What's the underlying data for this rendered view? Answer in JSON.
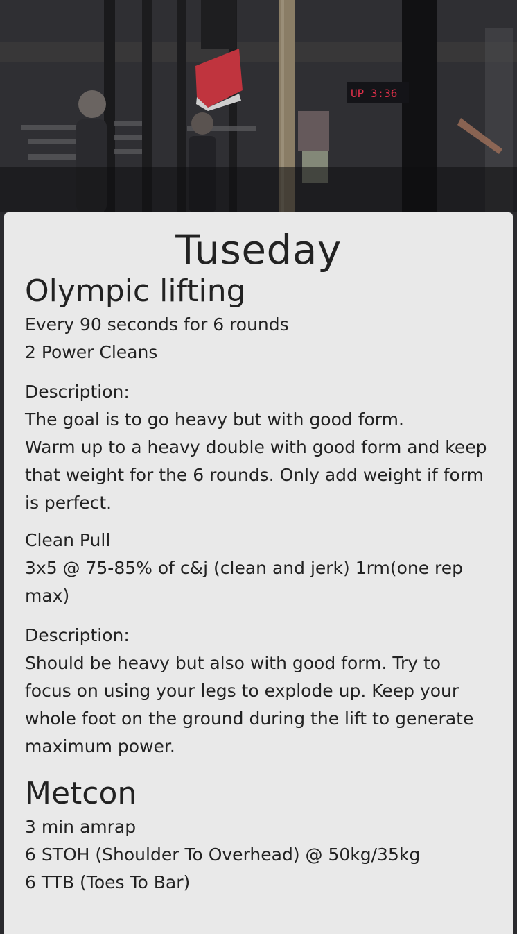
{
  "day_title": "Tuseday",
  "sections": [
    {
      "title": "Olympic lifting",
      "lines": [
        "Every 90 seconds for 6 rounds",
        "2 Power Cleans"
      ],
      "description_label": "Description:",
      "description_lines": [
        "The goal is to go heavy but with good form.",
        "Warm up to a heavy double with good form and keep that weight for the 6 rounds. Only add weight if form is perfect."
      ],
      "sub_exercise": {
        "title": "Clean Pull",
        "detail": "3x5 @ 75-85% of c&j (clean and jerk) 1rm(one rep max)",
        "description_label": "Description:",
        "description": "Should be heavy but also with good form. Try to focus on using your legs to explode up. Keep your whole foot on the ground during the lift to generate maximum power."
      }
    },
    {
      "title": "Metcon",
      "lines": [
        "3 min amrap",
        "6 STOH (Shoulder To Overhead) @ 50kg/35kg",
        "6 TTB (Toes To Bar)"
      ]
    }
  ],
  "colors": {
    "card_bg": "#e9e9e9",
    "text": "#222222",
    "page_bg": "#2a2a2e"
  },
  "icons": [
    "gym-hero-image"
  ]
}
